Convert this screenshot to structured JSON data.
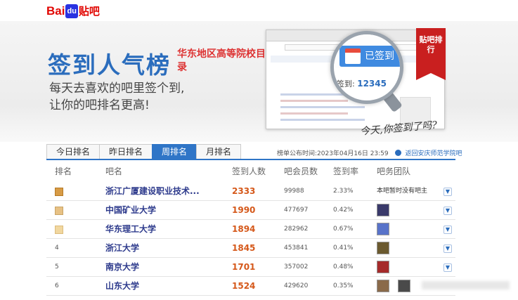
{
  "header": {
    "logo_bai": "Bai",
    "logo_du": "du",
    "logo_tieba": "贴吧"
  },
  "banner": {
    "title": "签到人气榜",
    "subtitle": "华东地区高等院校目录",
    "slogan_line1": "每天去喜欢的吧里签个到,",
    "slogan_line2": "让你的吧排名更高!",
    "signed_button": "已签到",
    "count_label": "签到:",
    "count_value": "12345",
    "ribbon": "贴吧排行",
    "handwriting": "今天,你签到了吗?"
  },
  "tabs": [
    {
      "label": "今日排名",
      "active": false
    },
    {
      "label": "昨日排名",
      "active": false
    },
    {
      "label": "周排名",
      "active": true
    },
    {
      "label": "月排名",
      "active": false
    }
  ],
  "notice": {
    "published": "榜单公布时间:2023年04月16日 23:59",
    "back_link": "返回安庆师范学院吧"
  },
  "table": {
    "headers": {
      "rank": "排名",
      "name": "吧名",
      "sign": "签到人数",
      "members": "吧会员数",
      "rate": "签到率",
      "team": "吧务团队"
    },
    "rows": [
      {
        "rank": "1",
        "name": "浙江广厦建设职业技术...",
        "sign": "2333",
        "members": "99988",
        "rate": "2.33%",
        "team": "本吧暂时没有吧主"
      },
      {
        "rank": "2",
        "name": "中国矿业大学",
        "sign": "1990",
        "members": "477697",
        "rate": "0.42%",
        "team": ""
      },
      {
        "rank": "3",
        "name": "华东理工大学",
        "sign": "1894",
        "members": "282962",
        "rate": "0.67%",
        "team": ""
      },
      {
        "rank": "4",
        "name": "浙江大学",
        "sign": "1845",
        "members": "453841",
        "rate": "0.41%",
        "team": ""
      },
      {
        "rank": "5",
        "name": "南京大学",
        "sign": "1701",
        "members": "357002",
        "rate": "0.48%",
        "team": ""
      },
      {
        "rank": "6",
        "name": "山东大学",
        "sign": "1524",
        "members": "429620",
        "rate": "0.35%",
        "team": ""
      }
    ]
  },
  "colors": {
    "brand_blue": "#2f75c7",
    "brand_red": "#e10602",
    "sign_orange": "#d5581a"
  }
}
